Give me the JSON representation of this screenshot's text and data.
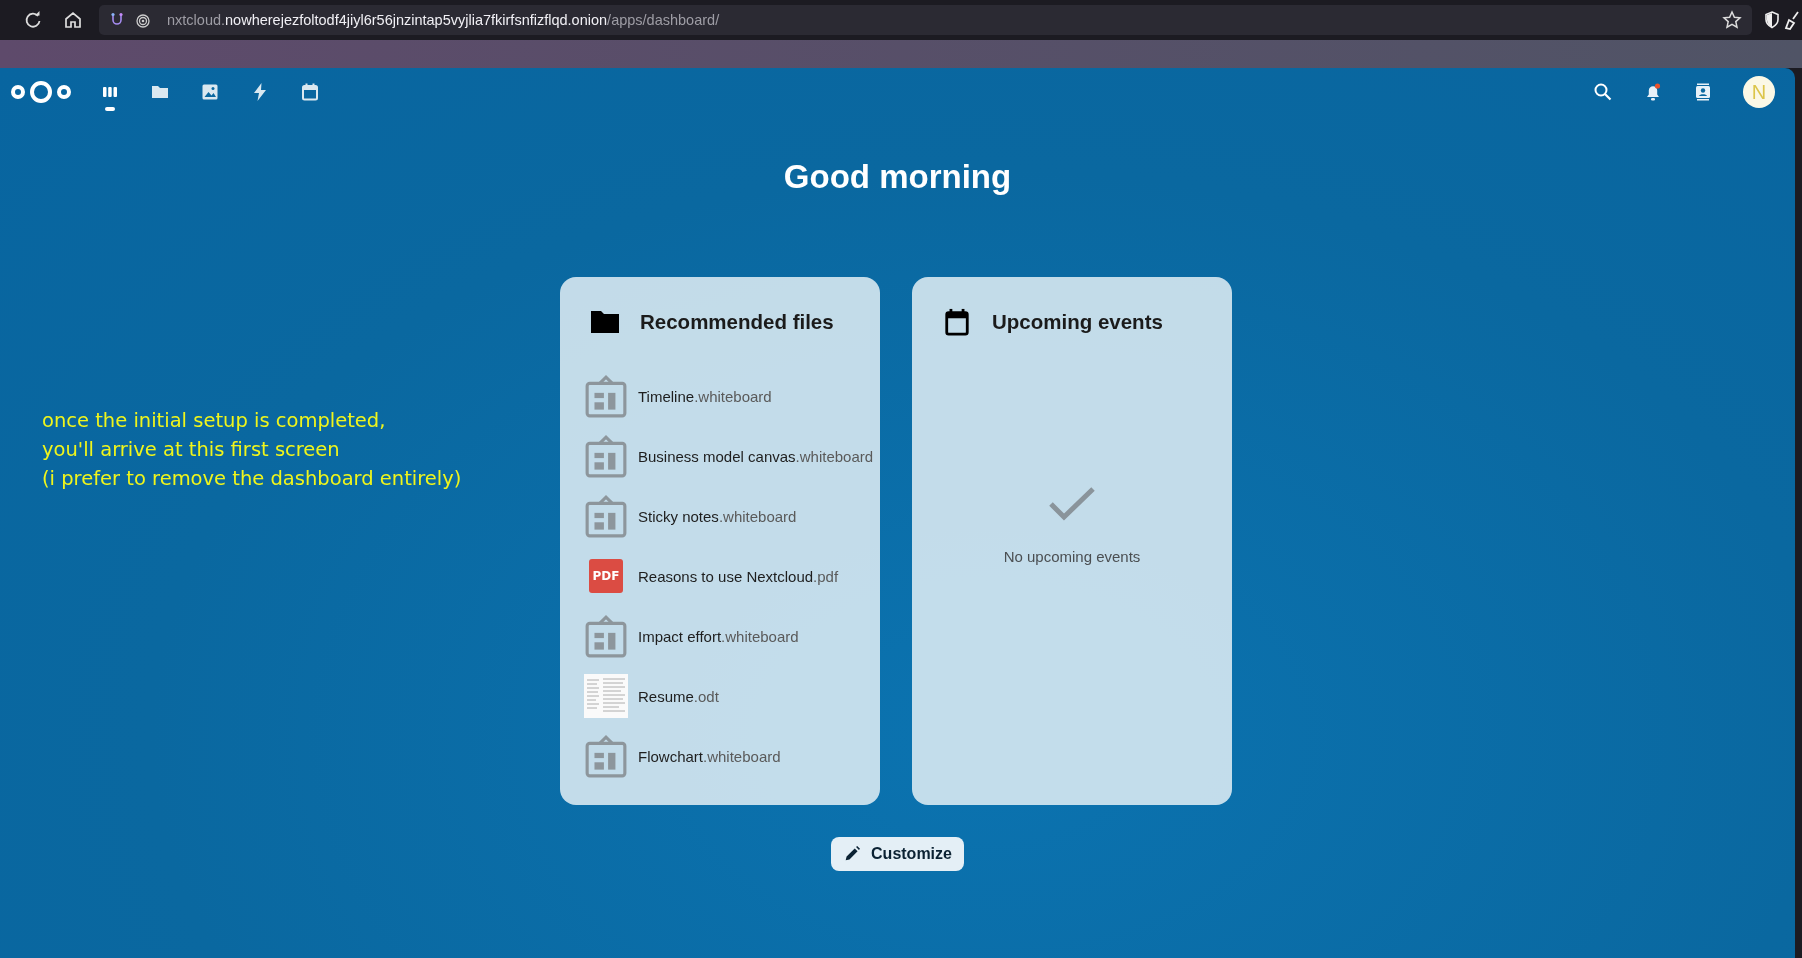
{
  "browser": {
    "url": {
      "prefix": "nxtcloud.",
      "domain": "nowherejezfoltodf4jiyl6r56jnzintap5vyjlia7fkirfsnfizflqd.onion",
      "path": "/apps/dashboard/"
    }
  },
  "header": {
    "apps": [
      {
        "kind": "dashboard",
        "selected": true
      },
      {
        "kind": "files",
        "selected": false
      },
      {
        "kind": "photos",
        "selected": false
      },
      {
        "kind": "activity",
        "selected": false
      },
      {
        "kind": "calendar",
        "selected": false
      }
    ],
    "notifications_unread": true,
    "avatar_letter": "N"
  },
  "greeting": "Good morning",
  "annotation": [
    "once the initial setup is completed,",
    "you'll arrive at this first screen",
    "(i prefer to remove the dashboard entirely)"
  ],
  "widgets": [
    {
      "kind": "files",
      "title": "Recommended files",
      "items": [
        {
          "kind": "whiteboard",
          "name": "Timeline",
          "ext": ".whiteboard"
        },
        {
          "kind": "whiteboard",
          "name": "Business model canvas",
          "ext": ".whiteboard"
        },
        {
          "kind": "whiteboard",
          "name": "Sticky notes",
          "ext": ".whiteboard"
        },
        {
          "kind": "pdf",
          "name": "Reasons to use Nextcloud",
          "ext": ".pdf",
          "badge": "PDF"
        },
        {
          "kind": "whiteboard",
          "name": "Impact effort",
          "ext": ".whiteboard"
        },
        {
          "kind": "thumbnail",
          "name": "Resume",
          "ext": ".odt"
        },
        {
          "kind": "whiteboard",
          "name": "Flowchart",
          "ext": ".whiteboard"
        }
      ]
    },
    {
      "kind": "events",
      "title": "Upcoming events",
      "empty_text": "No upcoming events"
    }
  ],
  "customize_label": "Customize"
}
